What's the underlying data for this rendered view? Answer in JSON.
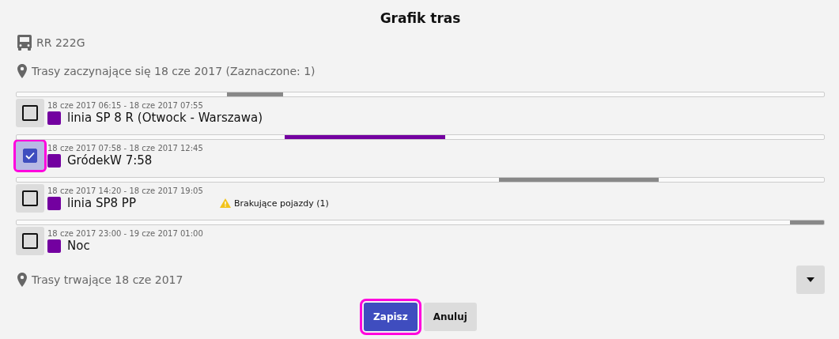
{
  "title": "Grafik tras",
  "vehicle": "RR 222G",
  "starting_section": {
    "label": "Trasy zaczynające się 18 cze 2017 (Zaznaczone: 1)"
  },
  "routes": [
    {
      "time_range": "18 cze 2017 06:15 - 18 cze 2017 07:55",
      "name": "linia SP 8 R (Otwock - Warszawa)",
      "color": "#7300a0",
      "checked": false,
      "focused": false
    },
    {
      "time_range": "18 cze 2017 07:58 - 18 cze 2017 12:45",
      "name": "GródekW 7:58",
      "color": "#7300a0",
      "checked": true,
      "focused": true
    },
    {
      "time_range": "18 cze 2017 14:20 - 18 cze 2017 19:05",
      "name": "linia SP8 PP",
      "color": "#7300a0",
      "checked": false,
      "focused": false,
      "warning": "Brakujące pojazdy (1)"
    },
    {
      "time_range": "18 cze 2017 23:00 - 19 cze 2017 01:00",
      "name": "Noc",
      "color": "#7300a0",
      "checked": false,
      "focused": false
    }
  ],
  "ongoing_section": {
    "label": "Trasy trwające 18 cze 2017",
    "expanded": false
  },
  "buttons": [
    {
      "kind": "primary",
      "label": "Zapisz",
      "focused": true
    },
    {
      "kind": "secondary",
      "label": "Anuluj",
      "focused": false
    }
  ]
}
